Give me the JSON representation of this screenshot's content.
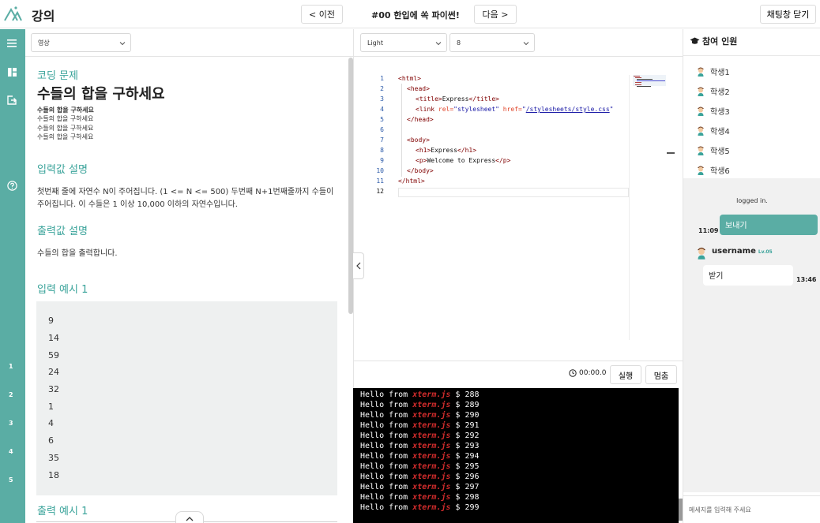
{
  "header": {
    "app_title": "강의",
    "prev_label": "< 이전",
    "lesson_title": "#00 한입에 쏙 파이썬!",
    "next_label": "다음 >",
    "close_chat_label": "채팅창 닫기"
  },
  "rail": {
    "icons": [
      "menu-icon",
      "dashboard-icon",
      "export-icon",
      "help-icon"
    ],
    "numbers": [
      "1",
      "2",
      "3",
      "4",
      "5"
    ]
  },
  "problem": {
    "view_select": "영상",
    "label": "코딩 문제",
    "title": "수들의 합을 구하세요",
    "description": [
      "수들의 합을 구하세요",
      "수들의 합을 구하세요",
      "수들의 합을 구하세요",
      "수들의 합을 구하세요"
    ],
    "input_heading": "입력값 설명",
    "input_desc": "첫번째 줄에 자연수 N이 주어집니다. (1 <= N <= 500) 두번째 N+1번째줄까지 수들이 주어집니다. 이 수들은 1 이상 10,000 이하의 자연수입니다.",
    "output_heading": "출력값 설명",
    "output_desc": "수들의 합을 출력합니다.",
    "example_in_heading": "입력 예시 1",
    "example_in_values": [
      "9",
      "14",
      "59",
      "24",
      "32",
      "1",
      "4",
      "6",
      "35",
      "18"
    ],
    "example_out_heading": "출력 예시 1"
  },
  "editor": {
    "theme": "Light",
    "font_size": "8",
    "line_numbers": [
      "1",
      "2",
      "3",
      "4",
      "5",
      "6",
      "7",
      "8",
      "9",
      "10",
      "11",
      "12"
    ],
    "code": {
      "l1_open": "<html>",
      "l2_open": "<head>",
      "l3_open": "<title>",
      "l3_text": "Express",
      "l3_close": "</title>",
      "l4_open": "<link ",
      "l4_rel_attr": "rel=",
      "l4_rel_val": "\"stylesheet\"",
      "l4_href_attr": " href=",
      "l4_href_q": "\"",
      "l4_href_val": "/stylesheets/style.css",
      "l4_href_q2": "\"",
      "l5_close": "</head>",
      "l7_open": "<body>",
      "l8_open": "<h1>",
      "l8_text": "Express",
      "l8_close": "</h1>",
      "l9_open": "<p>",
      "l9_text": "Welcome to Express",
      "l9_close": "</p>",
      "l10_close": "</body>",
      "l11_close": "</html>"
    }
  },
  "runbar": {
    "timer": "00:00.0",
    "run_label": "실행",
    "stop_label": "멈춤"
  },
  "terminal": {
    "prefix": "Hello from ",
    "emphasis": "xterm.js",
    "prompt": " $ ",
    "numbers": [
      "288",
      "289",
      "290",
      "291",
      "292",
      "293",
      "294",
      "295",
      "296",
      "297",
      "298",
      "299"
    ]
  },
  "chat": {
    "participants_heading": "참여 인원",
    "participants": [
      "학생1",
      "학생2",
      "학생3",
      "학생4",
      "학생5",
      "학생6"
    ],
    "system_message": "logged in.",
    "my_message": "보내기",
    "my_time": "11:09",
    "other_name": "username",
    "other_level": "Lv.05",
    "other_message": "받기",
    "other_time": "13:46",
    "input_placeholder": "메세지를 입력해 주세요"
  },
  "colors": {
    "accent": "#5aada4",
    "heading_teal": "#3aa39a",
    "terminal_bg": "#000000",
    "terminal_emphasis": "#d12c2c"
  }
}
